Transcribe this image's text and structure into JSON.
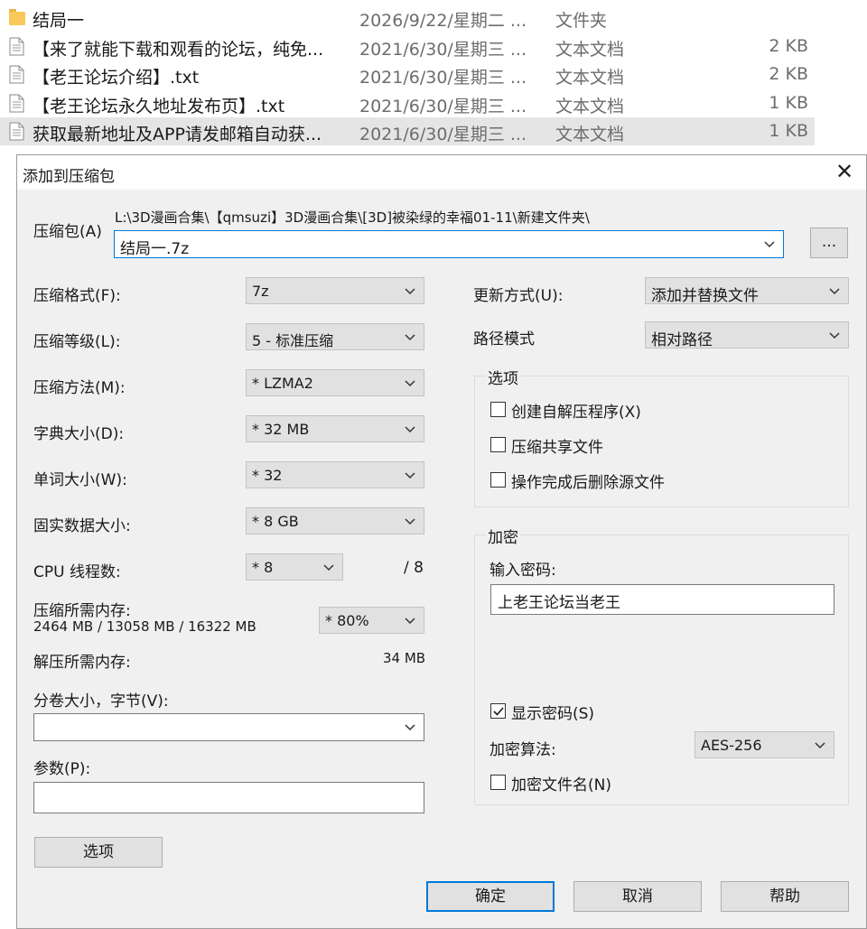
{
  "files": [
    {
      "name": "结局一",
      "date": "2026/9/22/星期二 ...",
      "type": "文件夹",
      "size": "",
      "icon": "folder-icon"
    },
    {
      "name": "【来了就能下载和观看的论坛，纯免...",
      "date": "2021/6/30/星期三 ...",
      "type": "文本文档",
      "size": "2 KB",
      "icon": "text-document-icon"
    },
    {
      "name": "【老王论坛介绍】.txt",
      "date": "2021/6/30/星期三 ...",
      "type": "文本文档",
      "size": "2 KB",
      "icon": "text-document-icon"
    },
    {
      "name": "【老王论坛永久地址发布页】.txt",
      "date": "2021/6/30/星期三 ...",
      "type": "文本文档",
      "size": "1 KB",
      "icon": "text-document-icon"
    },
    {
      "name": "获取最新地址及APP请发邮箱自动获...",
      "date": "2021/6/30/星期三 ...",
      "type": "文本文档",
      "size": "1 KB",
      "icon": "text-document-icon"
    }
  ],
  "dialog": {
    "title": "添加到压缩包",
    "close": "✕",
    "archive_label": "压缩包(A)",
    "archive_path": "L:\\3D漫画合集\\【qmsuzi】3D漫画合集\\[3D]被染绿的幸福01-11\\新建文件夹\\",
    "archive_name": "结局一.7z",
    "browse_label": "...",
    "format_label": "压缩格式(F):",
    "format_value": "7z",
    "level_label": "压缩等级(L):",
    "level_value": "5 - 标准压缩",
    "method_label": "压缩方法(M):",
    "method_value": "* LZMA2",
    "dict_label": "字典大小(D):",
    "dict_value": "* 32 MB",
    "word_label": "单词大小(W):",
    "word_value": "* 32",
    "solid_label": "固实数据大小:",
    "solid_value": "* 8 GB",
    "cpu_label": "CPU 线程数:",
    "cpu_value": "* 8",
    "cpu_max": "/ 8",
    "mem_label": "压缩所需内存:",
    "mem_value": "2464 MB / 13058 MB / 16322 MB",
    "mem_percent": "* 80%",
    "decomp_label": "解压所需内存:",
    "decomp_value": "34 MB",
    "volume_label": "分卷大小，字节(V):",
    "volume_value": "",
    "params_label": "参数(P):",
    "params_value": "",
    "options_button": "选项",
    "update_label": "更新方式(U):",
    "update_value": "添加并替换文件",
    "path_label": "路径模式",
    "path_value": "相对路径",
    "options_group": "选项",
    "opt_sfx": "创建自解压程序(X)",
    "opt_shared": "压缩共享文件",
    "opt_delete": "操作完成后删除源文件",
    "encrypt_group": "加密",
    "password_label": "输入密码:",
    "password_value": "上老王论坛当老王",
    "show_password": "显示密码(S)",
    "enc_method_label": "加密算法:",
    "enc_method_value": "AES-256",
    "encrypt_names": "加密文件名(N)",
    "ok": "确定",
    "cancel": "取消",
    "help": "帮助"
  },
  "checkbox_states": {
    "opt_sfx": false,
    "opt_shared": false,
    "opt_delete": false,
    "show_password": true,
    "encrypt_names": false
  },
  "colors": {
    "folder": "#f8c95a",
    "selected_row": "#e5e5e5",
    "default_button_border": "#0078d7",
    "dialog_bg": "#f0f0f0"
  }
}
